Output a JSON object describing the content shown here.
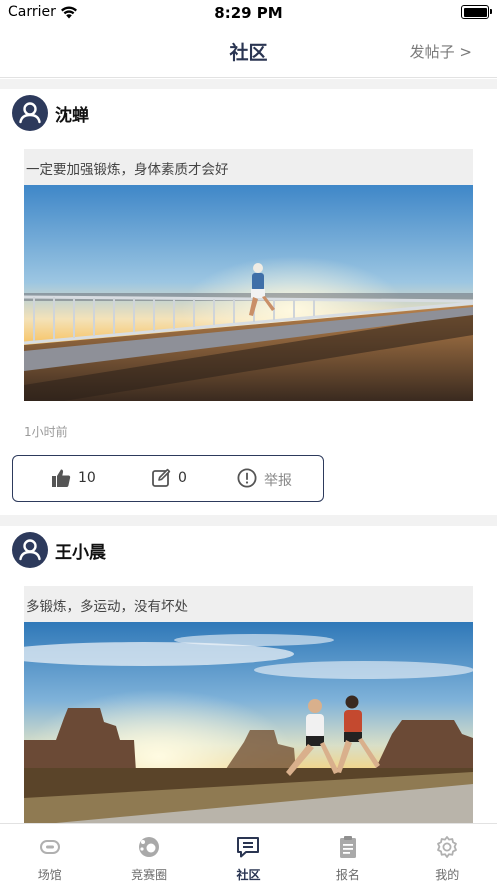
{
  "status_bar": {
    "carrier": "Carrier",
    "time": "8:29 PM"
  },
  "header": {
    "title": "社区",
    "action_label": "发帖子 >"
  },
  "posts": [
    {
      "author": "沈蝉",
      "text": "一定要加强锻炼，身体素质才会好",
      "image_subject": "runner-on-bridge-at-sunset",
      "timestamp": "1小时前",
      "like_count": "10",
      "comment_count": "0",
      "report_label": "举报"
    },
    {
      "author": "王小晨",
      "text": "多锻炼，多运动，没有坏处",
      "image_subject": "two-runners-desert-sunrise"
    }
  ],
  "tab_bar": {
    "active_index": 2,
    "items": [
      {
        "label": "场馆",
        "icon": "stadium-icon"
      },
      {
        "label": "竞赛圈",
        "icon": "competition-icon"
      },
      {
        "label": "社区",
        "icon": "community-icon"
      },
      {
        "label": "报名",
        "icon": "clipboard-icon"
      },
      {
        "label": "我的",
        "icon": "gear-icon"
      }
    ]
  },
  "colors": {
    "brand": "#2a3552",
    "avatar_bg": "#2d3a5c",
    "feed_bg": "#f2f2f2",
    "inactive": "#6b6b6b"
  }
}
